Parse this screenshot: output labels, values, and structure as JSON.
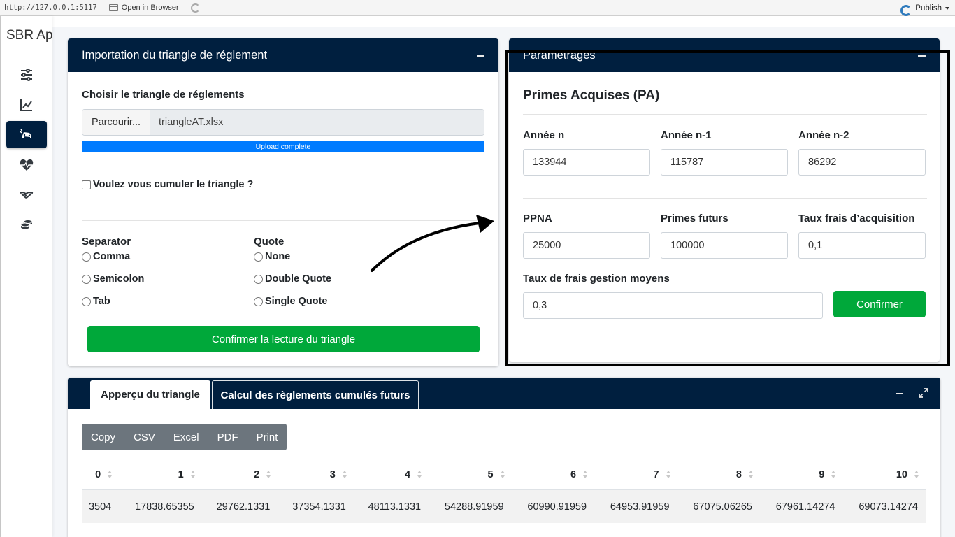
{
  "browser": {
    "url": "http://127.0.0.1:5117",
    "open_label": "Open in Browser",
    "publish_label": "Publish"
  },
  "sidebar": {
    "brand": "SBR App",
    "items": [
      {
        "icon": "sliders-icon",
        "active": false
      },
      {
        "icon": "chart-line-icon",
        "active": false
      },
      {
        "icon": "car-crash-icon",
        "active": true
      },
      {
        "icon": "heartbeat-icon",
        "active": false
      },
      {
        "icon": "handshake-icon",
        "active": false
      },
      {
        "icon": "coins-icon",
        "active": false
      }
    ]
  },
  "import_card": {
    "title": "Importation du triangle de réglement",
    "file_label": "Choisir le triangle de réglements",
    "browse_label": "Parcourir...",
    "file_name": "triangleAT.xlsx",
    "progress_text": "Upload complete",
    "progress": 1.0,
    "cumulate_label": "Voulez vous cumuler le triangle ?",
    "separator_label": "Separator",
    "separator_options": [
      "Comma",
      "Semicolon",
      "Tab"
    ],
    "quote_label": "Quote",
    "quote_options": [
      "None",
      "Double Quote",
      "Single Quote"
    ],
    "confirm_label": "Confirmer la lecture du triangle"
  },
  "params_card": {
    "title": "Paramètrages",
    "section_title": "Primes Acquises (PA)",
    "annee_n_label": "Année n",
    "annee_n_value": "133944",
    "annee_n1_label": "Année n-1",
    "annee_n1_value": "115787",
    "annee_n2_label": "Année n-2",
    "annee_n2_value": "86292",
    "ppna_label": "PPNA",
    "ppna_value": "25000",
    "primes_futurs_label": "Primes futurs",
    "primes_futurs_value": "100000",
    "taux_acq_label": "Taux frais d’acquisition",
    "taux_acq_value": "0,1",
    "taux_gestion_label": "Taux de frais gestion moyens",
    "taux_gestion_value": "0,3",
    "confirm_label": "Confirmer"
  },
  "table_card": {
    "tabs": [
      "Apperçu du triangle",
      "Calcul des règlements cumulés futurs"
    ],
    "export_buttons": [
      "Copy",
      "CSV",
      "Excel",
      "PDF",
      "Print"
    ],
    "columns": [
      "0",
      "1",
      "2",
      "3",
      "4",
      "5",
      "6",
      "7",
      "8",
      "9",
      "10"
    ],
    "rows": [
      [
        "3504",
        "17838.65355",
        "29762.1331",
        "37354.1331",
        "48113.1331",
        "54288.91959",
        "60990.91959",
        "64953.91959",
        "67075.06265",
        "67961.14274",
        "69073.14274"
      ]
    ]
  }
}
